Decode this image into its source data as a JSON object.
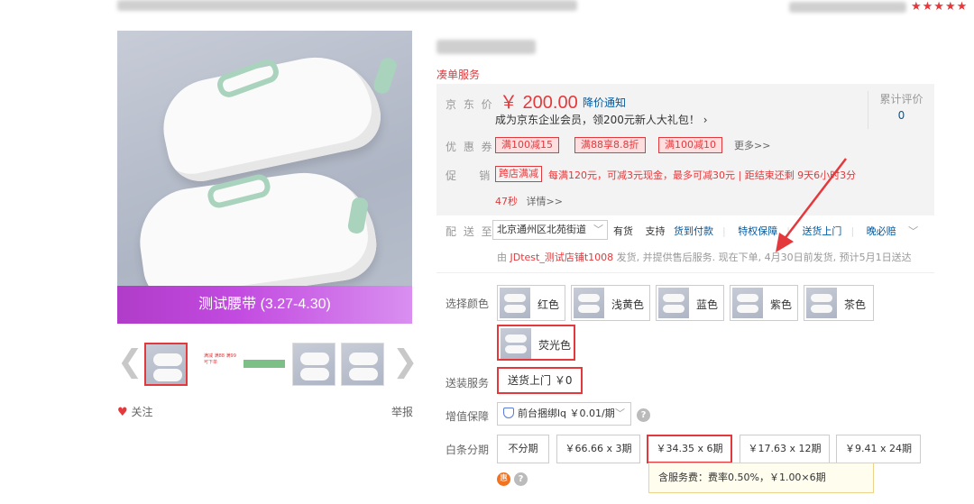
{
  "header": {
    "stars": "★★★★★"
  },
  "gallery": {
    "banner_text": "测试腰带 (3.27-4.30)",
    "prev_arrow": "❮",
    "next_arrow": "❯",
    "thumb_promo_text": "满减 满88 满99可下单",
    "follow_label": "关注",
    "report_label": "举报"
  },
  "product": {
    "service_tag": "凑单服务"
  },
  "price": {
    "label": "京 东 价",
    "value": "￥ 200.00",
    "notice_link": "降价通知",
    "vip_text": "成为京东企业会员，领200元新人大礼包！ ›",
    "review_label": "累计评价",
    "review_count": "0"
  },
  "coupons": {
    "label": "优 惠 券",
    "items": [
      "满100减15",
      "满88享8.8折",
      "满100减10"
    ],
    "more": "更多>>"
  },
  "promo": {
    "label": "促    销",
    "tag": "跨店满减",
    "text": "每满120元，可减3元现金，最多可减30元 | 距结束还剩 9天6小时3分",
    "text2": "47秒",
    "detail": "详情>>"
  },
  "delivery": {
    "label": "配 送 至",
    "address": "北京通州区北苑街道",
    "address_chevron": "﹀",
    "stock": "有货",
    "support": "支持",
    "options": [
      "货到付款",
      "特权保障",
      "送货上门",
      "晚必赔"
    ],
    "options_chevron": "﹀",
    "ship_prefix": "由",
    "store": "JDtest_测试店铺t1008",
    "ship_text": "发货, 并提供售后服务. 现在下单, 4月30日前发货, 预计5月1日送达"
  },
  "colors": {
    "label": "选择颜色",
    "items": [
      "红色",
      "浅黄色",
      "蓝色",
      "紫色",
      "茶色",
      "荧光色"
    ]
  },
  "service": {
    "label": "送装服务",
    "option": "送货上门 ￥0"
  },
  "addon": {
    "label": "增值保障",
    "option": "前台捆绑lq ￥0.01/期",
    "chevron": "﹀",
    "help": "?"
  },
  "installment": {
    "label": "白条分期",
    "options": [
      "不分期",
      "￥66.66 x 3期",
      "￥34.35 x 6期",
      "￥17.63 x 12期",
      "￥9.41 x 24期"
    ],
    "tooltip": "含服务费：费率0.50%，￥1.00×6期",
    "hui_icon": "惠",
    "help": "?"
  }
}
